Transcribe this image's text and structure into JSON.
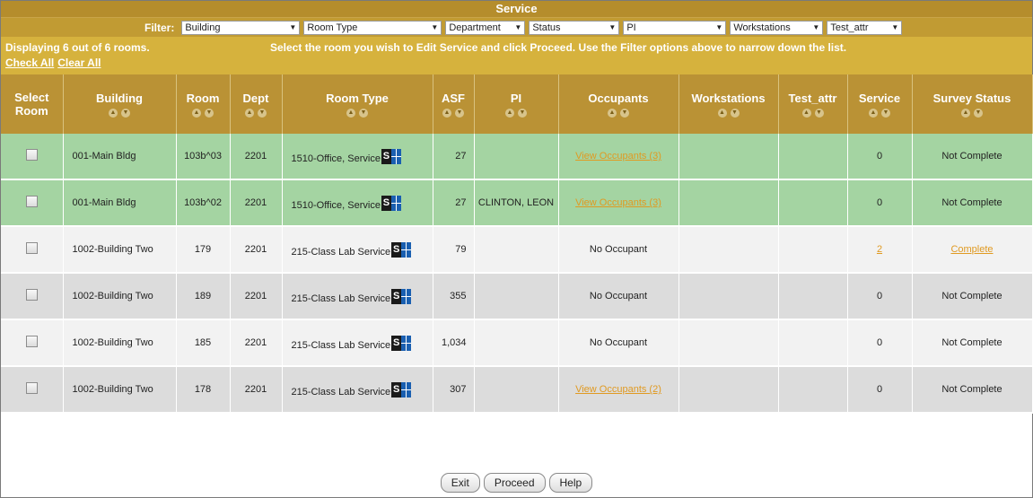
{
  "title": "Service",
  "filter": {
    "label": "Filter:",
    "selects": [
      {
        "value": "Building"
      },
      {
        "value": "Room Type"
      },
      {
        "value": "Department"
      },
      {
        "value": "Status"
      },
      {
        "value": "PI"
      },
      {
        "value": "Workstations"
      },
      {
        "value": "Test_attr"
      }
    ]
  },
  "info": {
    "count": "Displaying 6 out of 6 rooms.",
    "instructions": "Select the room you wish to Edit Service and click Proceed. Use the Filter options above to narrow down the list.",
    "check_all": "Check All",
    "clear_all": "Clear All"
  },
  "columns": [
    "Select Room",
    "Building",
    "Room",
    "Dept",
    "Room Type",
    "ASF",
    "PI",
    "Occupants",
    "Workstations",
    "Test_attr",
    "Service",
    "Survey Status"
  ],
  "rows": [
    {
      "building": "001-Main Bldg",
      "room": "103b^03",
      "dept": "2201",
      "room_type": "1510-Office, Service",
      "asf": "27",
      "pi": "",
      "occupants": "View Occupants (3)",
      "workstations": "",
      "test_attr": "",
      "service": "0",
      "status": "Not Complete"
    },
    {
      "building": "001-Main Bldg",
      "room": "103b^02",
      "dept": "2201",
      "room_type": "1510-Office, Service",
      "asf": "27",
      "pi": "CLINTON, LEON",
      "occupants": "View Occupants (3)",
      "workstations": "",
      "test_attr": "",
      "service": "0",
      "status": "Not Complete"
    },
    {
      "building": "1002-Building Two",
      "room": "179",
      "dept": "2201",
      "room_type": "215-Class Lab Service",
      "asf": "79",
      "pi": "",
      "occupants": "No Occupant",
      "workstations": "",
      "test_attr": "",
      "service": "2",
      "status": "Complete"
    },
    {
      "building": "1002-Building Two",
      "room": "189",
      "dept": "2201",
      "room_type": "215-Class Lab Service",
      "asf": "355",
      "pi": "",
      "occupants": "No Occupant",
      "workstations": "",
      "test_attr": "",
      "service": "0",
      "status": "Not Complete"
    },
    {
      "building": "1002-Building Two",
      "room": "185",
      "dept": "2201",
      "room_type": "215-Class Lab Service",
      "asf": "1,034",
      "pi": "",
      "occupants": "No Occupant",
      "workstations": "",
      "test_attr": "",
      "service": "0",
      "status": "Not Complete"
    },
    {
      "building": "1002-Building Two",
      "room": "178",
      "dept": "2201",
      "room_type": "215-Class Lab Service",
      "asf": "307",
      "pi": "",
      "occupants": "View Occupants (2)",
      "workstations": "",
      "test_attr": "",
      "service": "0",
      "status": "Not Complete"
    }
  ],
  "icon_letter": "S",
  "buttons": {
    "exit": "Exit",
    "proceed": "Proceed",
    "help": "Help"
  },
  "colors": {
    "header": "#ba9235",
    "info_bar": "#d6b23d",
    "row_highlight": "#a4d4a2",
    "link": "#e09a22"
  }
}
